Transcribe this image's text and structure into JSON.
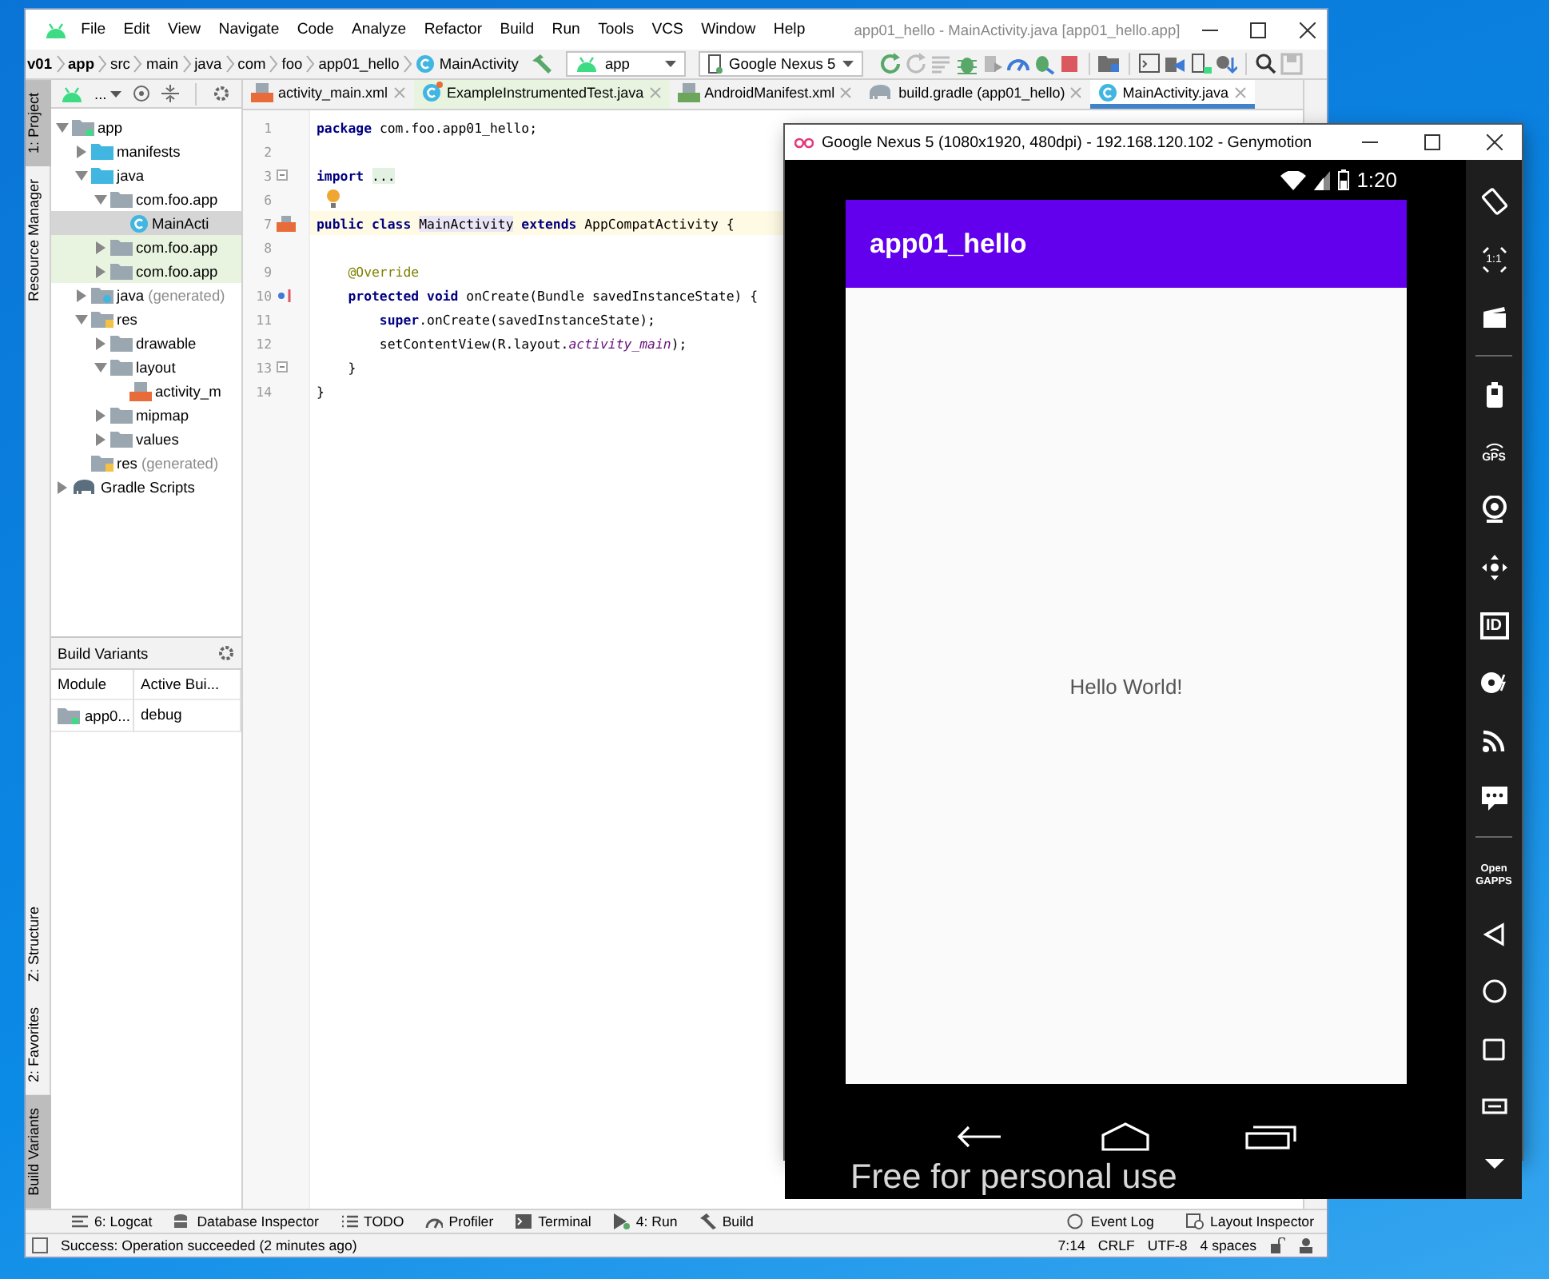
{
  "ide": {
    "title": "app01_hello - MainActivity.java [app01_hello.app]",
    "menu": [
      "File",
      "Edit",
      "View",
      "Navigate",
      "Code",
      "Analyze",
      "Refactor",
      "Build",
      "Run",
      "Tools",
      "VCS",
      "Window",
      "Help"
    ],
    "breadcrumbs": [
      {
        "label": "v01",
        "kind": "project"
      },
      {
        "label": "app",
        "kind": "module"
      },
      {
        "label": "src",
        "kind": "dir"
      },
      {
        "label": "main",
        "kind": "dir"
      },
      {
        "label": "java",
        "kind": "dir"
      },
      {
        "label": "com",
        "kind": "dir"
      },
      {
        "label": "foo",
        "kind": "dir"
      },
      {
        "label": "app01_hello",
        "kind": "dir"
      },
      {
        "label": "MainActivity",
        "kind": "class"
      }
    ],
    "run_config": "app",
    "device": "Google Nexus 5",
    "side_tabs_top": [
      {
        "label": "1: Project",
        "selected": true
      },
      {
        "label": "Resource Manager",
        "selected": false
      }
    ],
    "side_tabs_bottom": [
      {
        "label": "Z: Structure",
        "selected": false
      },
      {
        "label": "2: Favorites",
        "selected": false
      },
      {
        "label": "Build Variants",
        "selected": true
      }
    ],
    "view_selector": "...",
    "tree": [
      {
        "label": "app",
        "kind": "module",
        "expanded": true,
        "selected": false,
        "children": [
          {
            "label": "manifests",
            "kind": "src_folder",
            "expanded": false,
            "selected": false
          },
          {
            "label": "java",
            "kind": "src_folder",
            "expanded": true,
            "selected": false,
            "children": [
              {
                "label": "com.foo.app",
                "kind": "package",
                "expanded": true,
                "selected": false,
                "children": [
                  {
                    "label": "MainActi",
                    "kind": "class",
                    "selected": true
                  }
                ]
              },
              {
                "label": "com.foo.app",
                "kind": "test_package",
                "expanded": false,
                "selected": false
              },
              {
                "label": "com.foo.app",
                "kind": "test_package",
                "expanded": false,
                "selected": false
              }
            ]
          },
          {
            "label": "java",
            "note": "(generated)",
            "kind": "generated_folder",
            "expanded": false,
            "selected": false
          },
          {
            "label": "res",
            "kind": "res_folder",
            "expanded": true,
            "selected": false,
            "children": [
              {
                "label": "drawable",
                "kind": "package",
                "expanded": false,
                "selected": false
              },
              {
                "label": "layout",
                "kind": "package",
                "expanded": true,
                "selected": false,
                "children": [
                  {
                    "label": "activity_m",
                    "kind": "layout_file",
                    "selected": false
                  }
                ]
              },
              {
                "label": "mipmap",
                "kind": "package",
                "expanded": false,
                "selected": false
              },
              {
                "label": "values",
                "kind": "package",
                "expanded": false,
                "selected": false
              }
            ]
          },
          {
            "label": "res",
            "note": "(generated)",
            "kind": "res_folder",
            "selected": false
          }
        ]
      },
      {
        "label": "Gradle Scripts",
        "kind": "gradle",
        "expanded": false,
        "selected": false
      }
    ],
    "build_variants": {
      "title": "Build Variants",
      "columns": [
        "Module",
        "Active Bui..."
      ],
      "rows": [
        [
          "app0...",
          "debug"
        ]
      ]
    },
    "tabs": [
      {
        "label": "activity_main.xml",
        "kind": "xml",
        "selected": false
      },
      {
        "label": "ExampleInstrumentedTest.java",
        "kind": "test",
        "selected": false
      },
      {
        "label": "AndroidManifest.xml",
        "kind": "manifest",
        "selected": false
      },
      {
        "label": "build.gradle (app01_hello)",
        "kind": "gradle",
        "selected": false
      },
      {
        "label": "MainActivity.java",
        "kind": "java",
        "selected": true
      }
    ],
    "code": [
      {
        "num": "1",
        "current": false,
        "kind": "plain",
        "tokens": [
          {
            "kind": "kw",
            "text": "package "
          },
          {
            "kind": "plain",
            "text": "com.foo.app01_hello;"
          }
        ]
      },
      {
        "num": "2",
        "current": false,
        "kind": "plain"
      },
      {
        "num": "3",
        "current": false,
        "kind": "fold",
        "tokens": [
          {
            "kind": "kw",
            "text": "import "
          },
          {
            "kind": "folded",
            "text": "..."
          }
        ]
      },
      {
        "num": "6",
        "current": false,
        "kind": "bulb"
      },
      {
        "num": "7",
        "current": true,
        "kind": "layout",
        "tokens": [
          {
            "kind": "kw",
            "text": "public class "
          },
          {
            "kind": "usage",
            "text": "MainActivity"
          },
          {
            "kind": "kw",
            "text": " extends "
          },
          {
            "kind": "plain",
            "text": "AppCompatActivity {"
          }
        ]
      },
      {
        "num": "8",
        "current": false,
        "kind": "plain"
      },
      {
        "num": "9",
        "current": false,
        "kind": "plain",
        "tokens": [
          {
            "kind": "annotation",
            "text": "    @Override"
          }
        ]
      },
      {
        "num": "10",
        "current": false,
        "kind": "override",
        "tokens": [
          {
            "kind": "kw",
            "text": "    protected void "
          },
          {
            "kind": "plain",
            "text": "onCreate(Bundle savedInstanceState) {"
          }
        ]
      },
      {
        "num": "11",
        "current": false,
        "kind": "plain",
        "tokens": [
          {
            "kind": "kw",
            "text": "        super"
          },
          {
            "kind": "plain",
            "text": ".onCreate(savedInstanceState);"
          }
        ]
      },
      {
        "num": "12",
        "current": false,
        "kind": "plain",
        "tokens": [
          {
            "kind": "plain",
            "text": "        setContentView(R.layout."
          },
          {
            "kind": "field",
            "text": "activity_main"
          },
          {
            "kind": "plain",
            "text": ");"
          }
        ]
      },
      {
        "num": "13",
        "current": false,
        "kind": "fold",
        "tokens": [
          {
            "kind": "plain",
            "text": "    }"
          }
        ]
      },
      {
        "num": "14",
        "current": false,
        "kind": "plain",
        "tokens": [
          {
            "kind": "plain",
            "text": "}"
          }
        ]
      }
    ],
    "bottom_tools_left": [
      {
        "kind": "logcat",
        "label": "6: Logcat"
      },
      {
        "kind": "database",
        "label": "Database Inspector"
      },
      {
        "kind": "todo",
        "label": "TODO"
      },
      {
        "kind": "profiler",
        "label": "Profiler"
      },
      {
        "kind": "terminal",
        "label": "Terminal"
      },
      {
        "kind": "run",
        "label": "4: Run"
      },
      {
        "kind": "build",
        "label": "Build"
      }
    ],
    "bottom_tools_right": [
      {
        "kind": "event_log",
        "label": "Event Log"
      },
      {
        "kind": "layout_inspector",
        "label": "Layout Inspector"
      }
    ],
    "status": "Success: Operation succeeded (2 minutes ago)",
    "status_right": [
      "7:14",
      "CRLF",
      "UTF-8",
      "4 spaces"
    ]
  },
  "emulator": {
    "title": "Google Nexus 5 (1080x1920, 480dpi) - 192.168.120.102 - Genymotion",
    "clock": "1:20",
    "app_title": "app01_hello",
    "content": "Hello World!",
    "overlay": "Free for personal use",
    "tools": [
      {
        "kind": "rotate"
      },
      {
        "kind": "pixel",
        "label": "1:1"
      },
      {
        "kind": "capture"
      },
      {
        "kind": "divider"
      },
      {
        "kind": "battery"
      },
      {
        "kind": "gps",
        "label": "GPS"
      },
      {
        "kind": "webcam"
      },
      {
        "kind": "dpad"
      },
      {
        "kind": "id",
        "label": "ID"
      },
      {
        "kind": "disk"
      },
      {
        "kind": "cast"
      },
      {
        "kind": "sms"
      },
      {
        "kind": "divider"
      },
      {
        "kind": "gapps",
        "label": "Open GAPPS"
      },
      {
        "kind": "spacer"
      },
      {
        "kind": "back"
      },
      {
        "kind": "home"
      },
      {
        "kind": "recents"
      },
      {
        "kind": "menu"
      },
      {
        "kind": "down"
      }
    ]
  }
}
